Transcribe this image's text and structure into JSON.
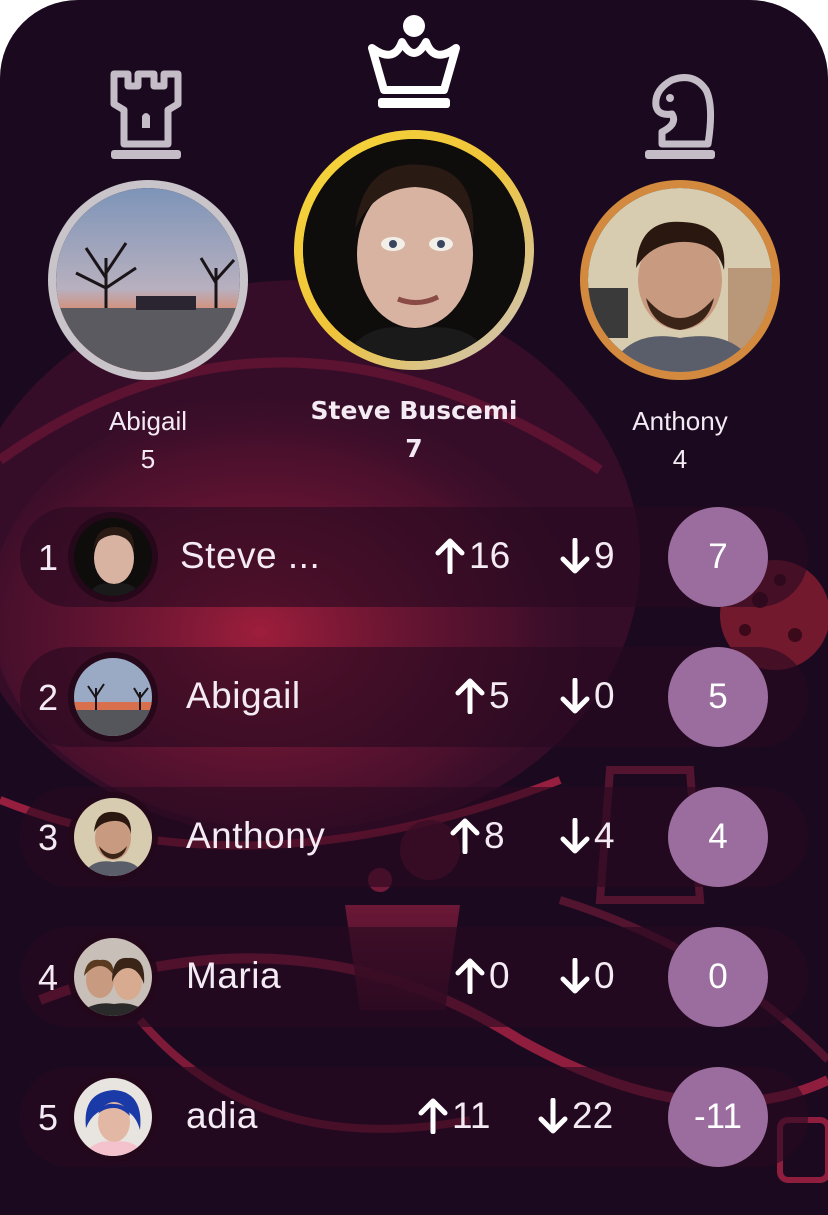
{
  "podium": {
    "first": {
      "name": "Steve Buscemi",
      "score": "7",
      "piece": "queen-icon",
      "ring": "#f1cf3b"
    },
    "second": {
      "name": "Abigail",
      "score": "5",
      "piece": "rook-icon",
      "ring": "#c9c4c9"
    },
    "third": {
      "name": "Anthony",
      "score": "4",
      "piece": "knight-icon",
      "ring": "#d38a3e"
    }
  },
  "leaderboard": [
    {
      "rank": "1",
      "name": "Steve ...",
      "up": "16",
      "down": "9",
      "score": "7"
    },
    {
      "rank": "2",
      "name": "Abigail",
      "up": "5",
      "down": "0",
      "score": "5"
    },
    {
      "rank": "3",
      "name": "Anthony",
      "up": "8",
      "down": "4",
      "score": "4"
    },
    {
      "rank": "4",
      "name": "Maria",
      "up": "0",
      "down": "0",
      "score": "0"
    },
    {
      "rank": "5",
      "name": "adia",
      "up": "11",
      "down": "22",
      "score": "-11"
    }
  ],
  "colors": {
    "background": "#1b0a1f",
    "accent": "#c0254a",
    "badge": "#9a6d9e",
    "piece": "#c4bcc6"
  }
}
